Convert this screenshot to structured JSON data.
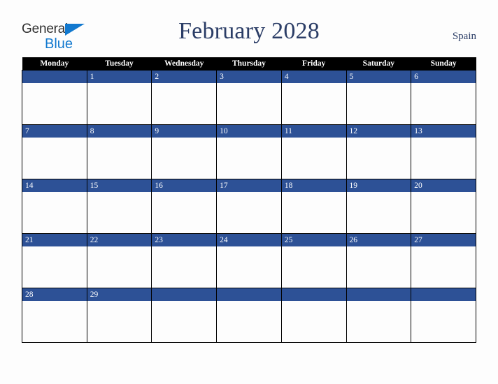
{
  "brand": {
    "name_part1": "General",
    "name_part2": "Blue",
    "triangle_icon": "triangle-icon",
    "color_primary": "#1279cf",
    "color_text": "#2e2e2e"
  },
  "header": {
    "title": "February 2028",
    "locale": "Spain",
    "title_color": "#2b3d66"
  },
  "calendar": {
    "month": "February",
    "year": "2028",
    "first_day_of_week": "Monday",
    "header_background": "#000000",
    "daynum_background": "#2d5196",
    "cell_background": "#fdfdfd",
    "border_color": "#000000",
    "weekdays": [
      "Monday",
      "Tuesday",
      "Wednesday",
      "Thursday",
      "Friday",
      "Saturday",
      "Sunday"
    ],
    "weeks": [
      [
        "",
        "1",
        "2",
        "3",
        "4",
        "5",
        "6"
      ],
      [
        "7",
        "8",
        "9",
        "10",
        "11",
        "12",
        "13"
      ],
      [
        "14",
        "15",
        "16",
        "17",
        "18",
        "19",
        "20"
      ],
      [
        "21",
        "22",
        "23",
        "24",
        "25",
        "26",
        "27"
      ],
      [
        "28",
        "29",
        "",
        "",
        "",
        "",
        ""
      ]
    ]
  }
}
